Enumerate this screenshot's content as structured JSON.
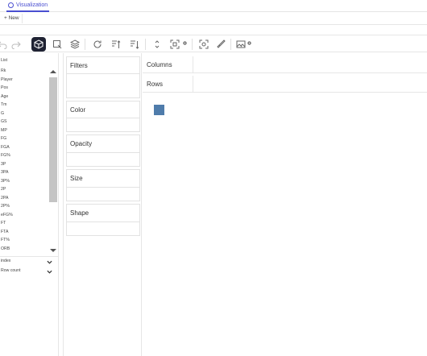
{
  "tabs": {
    "active_label": "Visualization"
  },
  "newbar": {
    "new_label": "+ New"
  },
  "toolbar": {
    "buttons": [
      "undo-icon",
      "redo-icon",
      "cube-icon",
      "shape-select-icon",
      "layers-icon",
      "refresh-icon",
      "sort-asc-icon",
      "sort-desc-icon",
      "expand-vertical-icon",
      "fit-icon",
      "lasso-icon",
      "brush-icon",
      "image-icon"
    ]
  },
  "fields": [
    "List",
    "Rk",
    "Player",
    "Pos",
    "Age",
    "Tm",
    "G",
    "GS",
    "MP",
    "FG",
    "FGA",
    "FG%",
    "3P",
    "3PA",
    "3P%",
    "2P",
    "2PA",
    "2P%",
    "eFG%",
    "FT",
    "FTA",
    "FT%",
    "ORB"
  ],
  "fields_bottom": [
    "index",
    "Row count"
  ],
  "shelves": {
    "filters": "Filters",
    "color": "Color",
    "opacity": "Opacity",
    "size": "Size",
    "shape": "Shape"
  },
  "axes": {
    "columns": "Columns",
    "rows": "Rows"
  },
  "colors": {
    "accent": "#4a4fd1",
    "mark": "#4f7cab",
    "active_tool": "#1f2233"
  }
}
